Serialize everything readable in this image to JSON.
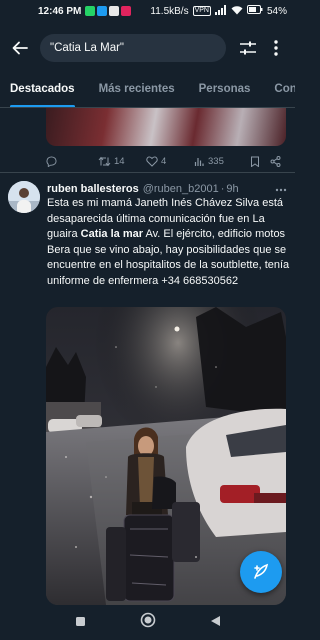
{
  "status_bar": {
    "time": "12:46 PM",
    "net_speed": "11.5kB/s",
    "vpn": "VPN",
    "battery": "54%"
  },
  "search": {
    "query": "\"Catia La Mar\""
  },
  "tabs": [
    {
      "label": "Destacados",
      "active": true
    },
    {
      "label": "Más recientes",
      "active": false
    },
    {
      "label": "Personas",
      "active": false
    },
    {
      "label": "Conteni",
      "active": false
    }
  ],
  "prev_tweet": {
    "replies": "",
    "retweets": "14",
    "likes": "4",
    "views": "335"
  },
  "tweet": {
    "name": "ruben ballesteros",
    "handle": "@ruben_b2001",
    "separator": "·",
    "ago": "9h",
    "text_before": "Esta es mi mamá Janeth Inés Chávez Silva está desaparecida última comunicación fue en La guaira ",
    "text_bold": "Catia la mar",
    "text_after": " Av. El ejército, edificio motos Bera que se vino abajo, hay posibilidades que se encuentre en el hospitalitos de la soutblette, tenía uniforme de enfermera +34 668530562"
  },
  "colors": {
    "background": "#15202b",
    "accent": "#1d9bf0",
    "muted": "#8b98a5",
    "border": "#38444d"
  },
  "icons": [
    "back-arrow-icon",
    "filter-icon",
    "more-vertical-icon",
    "reply-icon",
    "retweet-icon",
    "like-icon",
    "views-icon",
    "bookmark-icon",
    "share-icon",
    "compose-icon"
  ]
}
